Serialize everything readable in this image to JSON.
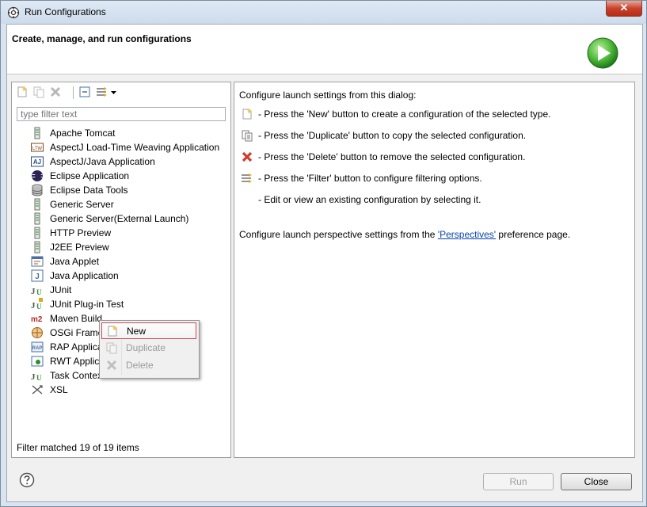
{
  "window": {
    "title": "Run Configurations",
    "close_label": "✕"
  },
  "header": {
    "title": "Create, manage, and run configurations"
  },
  "filter": {
    "placeholder": "type filter text"
  },
  "tree": {
    "items": [
      {
        "label": "Apache Tomcat",
        "icon": "server-icon"
      },
      {
        "label": "AspectJ Load-Time Weaving Application",
        "icon": "ltw-icon"
      },
      {
        "label": "AspectJ/Java Application",
        "icon": "aj-icon"
      },
      {
        "label": "Eclipse Application",
        "icon": "eclipse-icon"
      },
      {
        "label": "Eclipse Data Tools",
        "icon": "database-icon"
      },
      {
        "label": "Generic Server",
        "icon": "server-icon"
      },
      {
        "label": "Generic Server(External Launch)",
        "icon": "server-icon"
      },
      {
        "label": "HTTP Preview",
        "icon": "server-icon"
      },
      {
        "label": "J2EE Preview",
        "icon": "server-icon"
      },
      {
        "label": "Java Applet",
        "icon": "applet-icon"
      },
      {
        "label": "Java Application",
        "icon": "java-app-icon"
      },
      {
        "label": "JUnit",
        "icon": "junit-icon"
      },
      {
        "label": "JUnit Plug-in Test",
        "icon": "junit-plugin-icon"
      },
      {
        "label": "Maven Build",
        "icon": "maven-icon"
      },
      {
        "label": "OSGi Frame",
        "icon": "osgi-icon"
      },
      {
        "label": "RAP Applica",
        "icon": "rap-icon"
      },
      {
        "label": "RWT Applic",
        "icon": "rwt-icon"
      },
      {
        "label": "Task Context Test",
        "icon": "task-context-icon"
      },
      {
        "label": "XSL",
        "icon": "xsl-icon"
      }
    ]
  },
  "status": {
    "text": "Filter matched 19 of 19 items"
  },
  "right": {
    "intro": "Configure launch settings from this dialog:",
    "hints": [
      {
        "icon": "new-config-icon",
        "text": "- Press the 'New' button to create a configuration of the selected type."
      },
      {
        "icon": "duplicate-icon",
        "text": "- Press the 'Duplicate' button to copy the selected configuration."
      },
      {
        "icon": "delete-icon",
        "text": "- Press the 'Delete' button to remove the selected configuration."
      },
      {
        "icon": "filter-icon",
        "text": "- Press the 'Filter' button to configure filtering options."
      },
      {
        "icon": "",
        "text": "- Edit or view an existing configuration by selecting it."
      }
    ],
    "perspective_prefix": "Configure launch perspective settings from the ",
    "perspective_link": "'Perspectives'",
    "perspective_suffix": " preference page."
  },
  "context_menu": {
    "items": [
      {
        "label": "New",
        "enabled": true
      },
      {
        "label": "Duplicate",
        "enabled": false
      },
      {
        "label": "Delete",
        "enabled": false
      }
    ]
  },
  "buttons": {
    "run": "Run",
    "close": "Close"
  },
  "colors": {
    "accent_red": "#d33a2c",
    "link": "#0645ad",
    "run_green": "#3aa83a"
  }
}
